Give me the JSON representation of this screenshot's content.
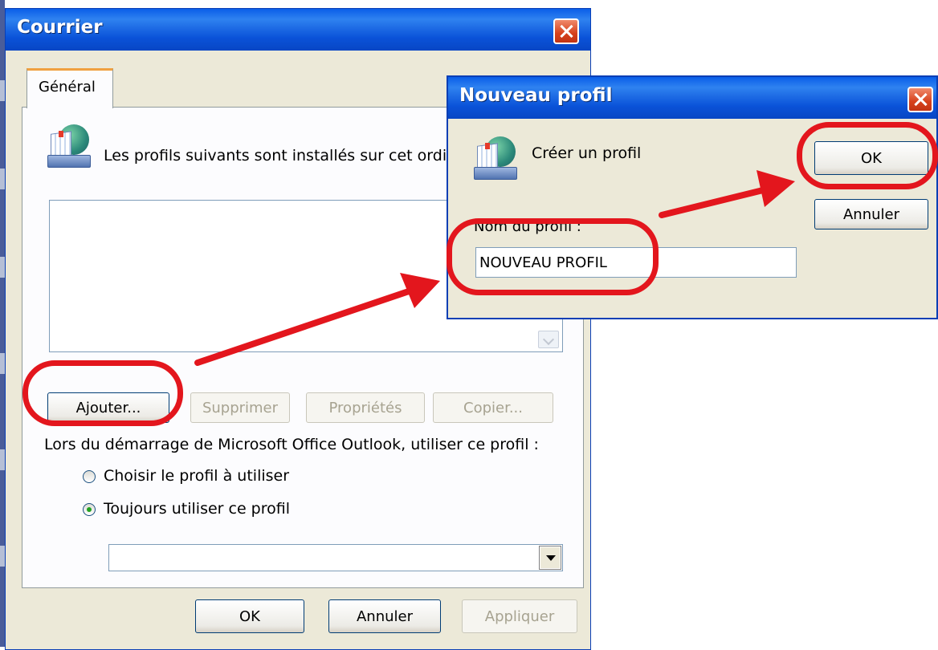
{
  "main_dialog": {
    "title": "Courrier",
    "tab_label": "Général",
    "intro_text": "Les profils suivants sont installés sur cet ordi",
    "buttons": {
      "add": "Ajouter...",
      "delete": "Supprimer",
      "properties": "Propriétés",
      "copy": "Copier..."
    },
    "startup_label": "Lors du démarrage de Microsoft Office Outlook, utiliser ce profil :",
    "radio_choose": "Choisir le profil à utiliser",
    "radio_always": "Toujours utiliser ce profil",
    "selected_option": "always",
    "profile_combo_value": "",
    "footer": {
      "ok": "OK",
      "cancel": "Annuler",
      "apply": "Appliquer"
    }
  },
  "new_profile_dialog": {
    "title": "Nouveau profil",
    "create_text": "Créer un profil",
    "name_label": "Nom du profil :",
    "name_value": "NOUVEAU PROFIL",
    "ok": "OK",
    "cancel": "Annuler"
  },
  "colors": {
    "title_bar": "#0a5ee8",
    "dialog_bg": "#ece9d8",
    "highlight": "#e3161d"
  },
  "icons": [
    "close-icon",
    "address-book-icon",
    "dropdown-arrow-icon"
  ]
}
